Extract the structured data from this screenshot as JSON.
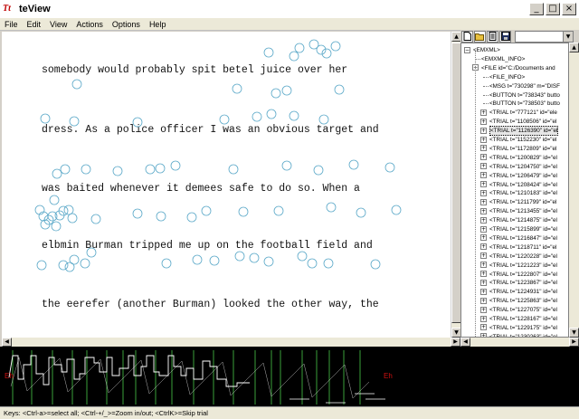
{
  "window": {
    "app_icon": "Tt",
    "title": "teView",
    "minimize": "_",
    "maximize": "□",
    "close": "×"
  },
  "menu": {
    "items": [
      "File",
      "Edit",
      "View",
      "Actions",
      "Options",
      "Help"
    ]
  },
  "text_view": {
    "lines": [
      "somebody would probably spit betel juice over her",
      "dress. As a police officer I was an obvious target and",
      "was baited whenever it demees safe to do so. When a",
      "elbmin Burman tripped me up on the football field and",
      "the eerefer (another Burman) looked the other way, the"
    ],
    "fixation_color": "#5aa8c8"
  },
  "toolbar": {
    "icons": [
      "new-file-icon",
      "open-folder-icon",
      "properties-icon",
      "save-icon"
    ],
    "select_value": ""
  },
  "tree": {
    "nodes": [
      {
        "label": "<EMXML>",
        "toggle": "−"
      },
      {
        "label": "<EMXML_INFO>",
        "toggle": ""
      },
      {
        "label": "<FILE id=\"C:/Documents and",
        "toggle": "−"
      },
      {
        "label": "<FILE_INFO>",
        "toggle": ""
      },
      {
        "label": "<MSG t=\"730298\" m=\"DISF",
        "toggle": ""
      },
      {
        "label": "<BUTTON t=\"738343\" butto",
        "toggle": ""
      },
      {
        "label": "<BUTTON t=\"738503\" butto",
        "toggle": ""
      },
      {
        "label": "<TRIAL t=\"777121\" id=\"ele",
        "toggle": "+"
      },
      {
        "label": "<TRIAL t=\"1108506\" id=\"el",
        "toggle": "+"
      },
      {
        "label": "<TRIAL t=\"1126390\" id=\"el",
        "toggle": "+",
        "selected": true
      },
      {
        "label": "<TRIAL t=\"1152230\" id=\"el",
        "toggle": "+"
      },
      {
        "label": "<TRIAL t=\"1172809\" id=\"el",
        "toggle": "+"
      },
      {
        "label": "<TRIAL t=\"1200829\" id=\"el",
        "toggle": "+"
      },
      {
        "label": "<TRIAL t=\"1204750\" id=\"el",
        "toggle": "+"
      },
      {
        "label": "<TRIAL t=\"1206479\" id=\"el",
        "toggle": "+"
      },
      {
        "label": "<TRIAL t=\"1208424\" id=\"el",
        "toggle": "+"
      },
      {
        "label": "<TRIAL t=\"1210183\" id=\"el",
        "toggle": "+"
      },
      {
        "label": "<TRIAL t=\"1211799\" id=\"el",
        "toggle": "+"
      },
      {
        "label": "<TRIAL t=\"1213455\" id=\"el",
        "toggle": "+"
      },
      {
        "label": "<TRIAL t=\"1214875\" id=\"el",
        "toggle": "+"
      },
      {
        "label": "<TRIAL t=\"1215899\" id=\"el",
        "toggle": "+"
      },
      {
        "label": "<TRIAL t=\"1216847\" id=\"el",
        "toggle": "+"
      },
      {
        "label": "<TRIAL t=\"1218711\" id=\"el",
        "toggle": "+"
      },
      {
        "label": "<TRIAL t=\"1220228\" id=\"el",
        "toggle": "+"
      },
      {
        "label": "<TRIAL t=\"1221223\" id=\"el",
        "toggle": "+"
      },
      {
        "label": "<TRIAL t=\"1222807\" id=\"el",
        "toggle": "+"
      },
      {
        "label": "<TRIAL t=\"1223867\" id=\"el",
        "toggle": "+"
      },
      {
        "label": "<TRIAL t=\"1224931\" id=\"el",
        "toggle": "+"
      },
      {
        "label": "<TRIAL t=\"1225863\" id=\"el",
        "toggle": "+"
      },
      {
        "label": "<TRIAL t=\"1227075\" id=\"el",
        "toggle": "+"
      },
      {
        "label": "<TRIAL t=\"1228167\" id=\"el",
        "toggle": "+"
      },
      {
        "label": "<TRIAL t=\"1229175\" id=\"el",
        "toggle": "+"
      },
      {
        "label": "<TRIAL t=\"1230263\" id=\"el",
        "toggle": "+"
      }
    ]
  },
  "plot": {
    "left_marker": "Eh",
    "right_marker": "Eh",
    "grid_color": "#3aa03a",
    "trace_color": "#ffffff"
  },
  "status": {
    "text": "Keys: <Ctrl-a>=select all; <Ctrl-+/_>=Zoom in/out; <CtrlK>=Skip trial"
  }
}
